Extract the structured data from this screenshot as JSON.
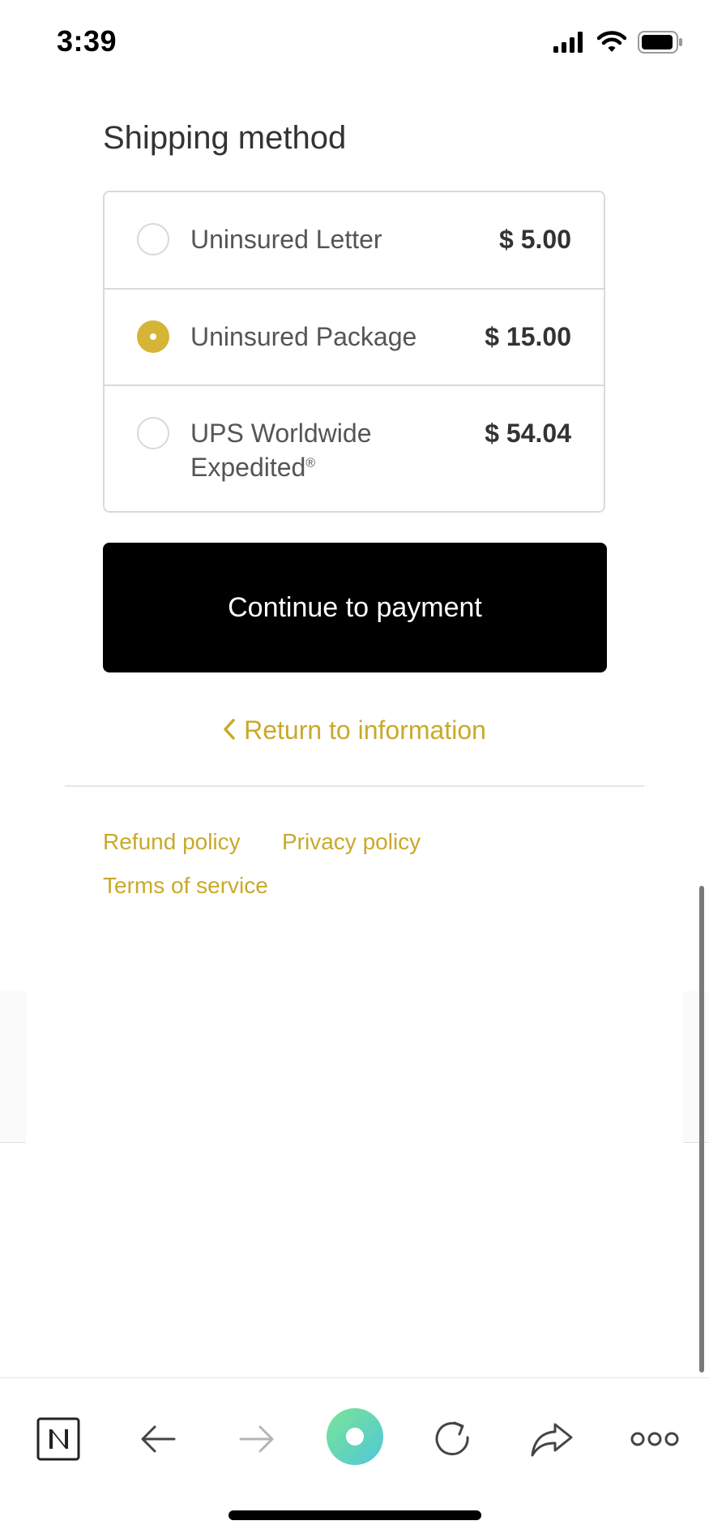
{
  "status_bar": {
    "time": "3:39",
    "icons": [
      "signal-icon",
      "wifi-icon",
      "battery-icon"
    ]
  },
  "shipping": {
    "heading": "Shipping method",
    "options": [
      {
        "name": "Uninsured Letter",
        "name_mark": "",
        "price": "$ 5.00",
        "selected": false
      },
      {
        "name": "Uninsured Package",
        "name_mark": "",
        "price": "$ 15.00",
        "selected": true
      },
      {
        "name": "UPS Worldwide Expedited",
        "name_mark": "®",
        "price": "$ 54.04",
        "selected": false
      }
    ]
  },
  "actions": {
    "continue_label": "Continue to payment",
    "return_label": "Return to information"
  },
  "footer": {
    "links": [
      "Refund policy",
      "Privacy policy",
      "Terms of service"
    ]
  },
  "toolbar": {
    "items": [
      "notion-icon",
      "back-arrow-icon",
      "forward-arrow-icon",
      "home-circle-icon",
      "reload-icon",
      "share-icon",
      "more-icon"
    ]
  },
  "colors": {
    "accent": "#c9a92a",
    "radio_selected": "#d6b536",
    "button": "#000000",
    "border": "#d9d9d9"
  }
}
